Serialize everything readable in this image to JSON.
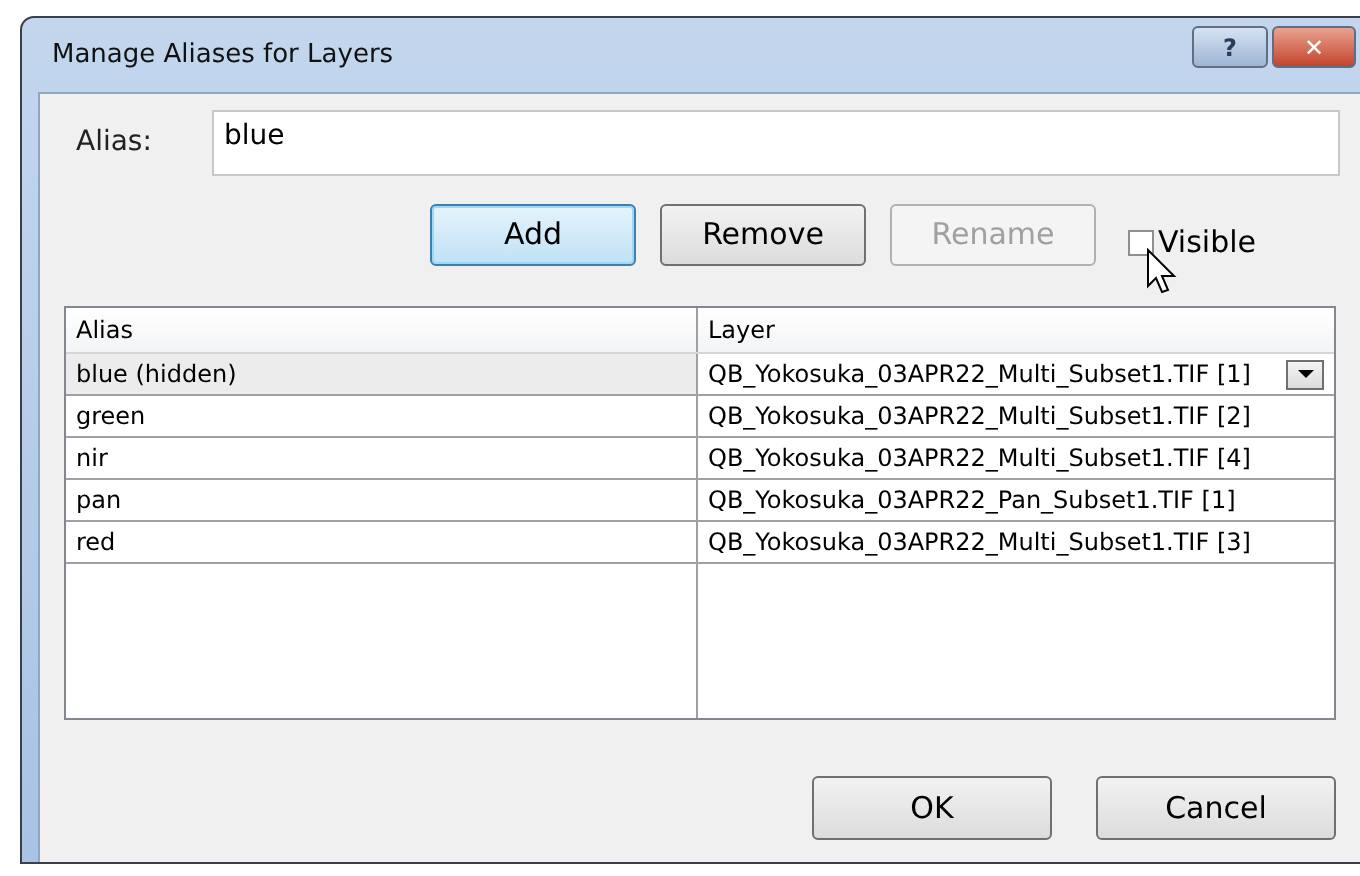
{
  "window": {
    "title": "Manage Aliases for Layers",
    "title_buttons": [
      "?",
      "✕"
    ]
  },
  "alias_field": {
    "label": "Alias:",
    "value": "blue"
  },
  "buttons": [
    {
      "label": "Add",
      "default": true,
      "disabled": false
    },
    {
      "label": "Remove",
      "default": false,
      "disabled": false
    },
    {
      "label": "Rename",
      "default": false,
      "disabled": true
    }
  ],
  "visible_checkbox": {
    "label": "Visible",
    "checked": false
  },
  "table": {
    "columns": [
      "Alias",
      "Layer"
    ],
    "rows": [
      {
        "alias": "blue (hidden)",
        "layer": "QB_Yokosuka_03APR22_Multi_Subset1.TIF [1]",
        "selected": true
      },
      {
        "alias": "green",
        "layer": "QB_Yokosuka_03APR22_Multi_Subset1.TIF [2]",
        "selected": false
      },
      {
        "alias": "nir",
        "layer": "QB_Yokosuka_03APR22_Multi_Subset1.TIF [4]",
        "selected": false
      },
      {
        "alias": "pan",
        "layer": "QB_Yokosuka_03APR22_Pan_Subset1.TIF [1]",
        "selected": false
      },
      {
        "alias": "red",
        "layer": "QB_Yokosuka_03APR22_Multi_Subset1.TIF [3]",
        "selected": false
      }
    ]
  },
  "footer_buttons": [
    "OK",
    "Cancel"
  ]
}
